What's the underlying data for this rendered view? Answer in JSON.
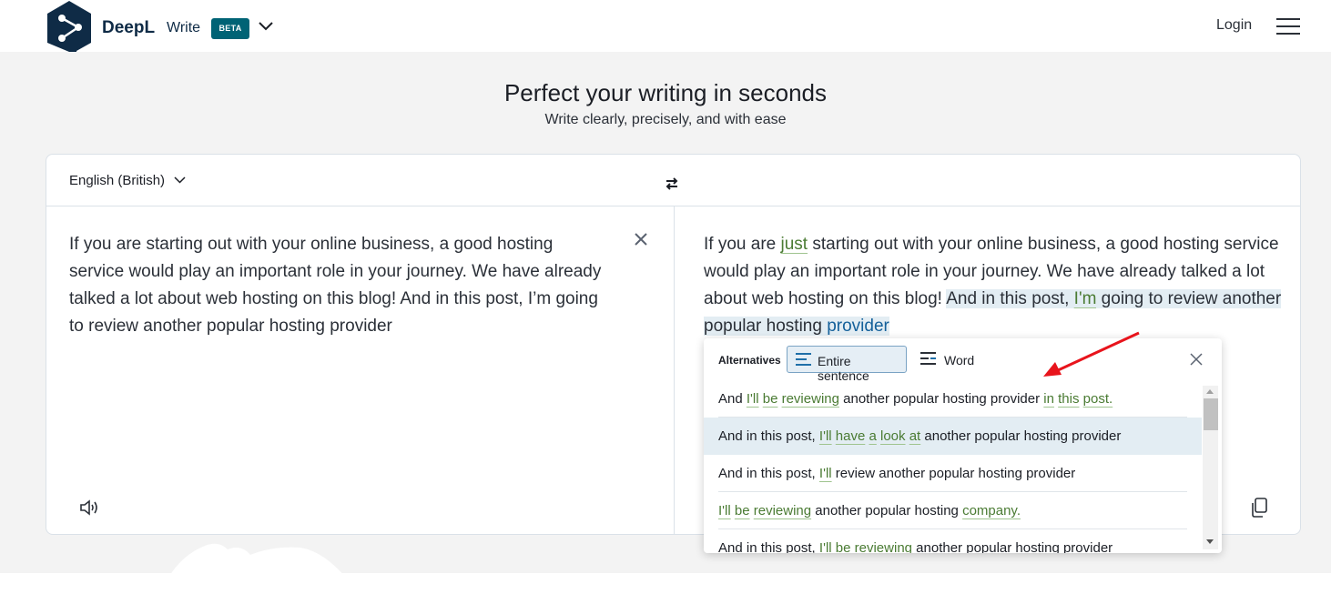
{
  "header": {
    "brand": "DeepL",
    "product": "Write",
    "badge": "BETA",
    "login": "Login"
  },
  "hero": {
    "title": "Perfect your writing in seconds",
    "subtitle": "Write clearly, precisely, and with ease"
  },
  "editor": {
    "language": "English (British)",
    "source_text": "If you are starting out with your online business, a good hosting service would play an important role in your journey. We have already talked a lot about web hosting on this blog! And in this post, I’m going to review another popular hosting provider",
    "output": {
      "p1": "If you are ",
      "p2": "just",
      "p3": " starting out with your online business, a good hosting service would play an important role in your journey. We have already talked a lot about web hosting on this blog!",
      "p4": " ",
      "p5": "And in this post, ",
      "p6": "I'm",
      "p7": " going to review another popular hosting ",
      "p8": "provider"
    }
  },
  "alternatives": {
    "label": "Alternatives",
    "tab_sentence": "Entire sentence",
    "tab_word": "Word",
    "items": [
      [
        {
          "t": "And ",
          "c": false
        },
        {
          "t": "I'll",
          "c": true
        },
        {
          "t": " ",
          "c": false
        },
        {
          "t": "be",
          "c": true
        },
        {
          "t": " ",
          "c": false
        },
        {
          "t": "reviewing",
          "c": true
        },
        {
          "t": " another popular hosting provider ",
          "c": false
        },
        {
          "t": "in",
          "c": true
        },
        {
          "t": " ",
          "c": false
        },
        {
          "t": "this",
          "c": true
        },
        {
          "t": " ",
          "c": false
        },
        {
          "t": "post.",
          "c": true
        }
      ],
      [
        {
          "t": "And in this post, ",
          "c": false
        },
        {
          "t": "I'll",
          "c": true
        },
        {
          "t": " ",
          "c": false
        },
        {
          "t": "have",
          "c": true
        },
        {
          "t": " ",
          "c": false
        },
        {
          "t": "a",
          "c": true
        },
        {
          "t": " ",
          "c": false
        },
        {
          "t": "look",
          "c": true
        },
        {
          "t": " ",
          "c": false
        },
        {
          "t": "at",
          "c": true
        },
        {
          "t": " another popular hosting provider",
          "c": false
        }
      ],
      [
        {
          "t": "And in this post, ",
          "c": false
        },
        {
          "t": "I'll",
          "c": true
        },
        {
          "t": " review another popular hosting provider",
          "c": false
        }
      ],
      [
        {
          "t": "I'll",
          "c": true
        },
        {
          "t": " ",
          "c": false
        },
        {
          "t": "be",
          "c": true
        },
        {
          "t": " ",
          "c": false
        },
        {
          "t": "reviewing",
          "c": true
        },
        {
          "t": " another popular hosting ",
          "c": false
        },
        {
          "t": "company.",
          "c": true
        }
      ],
      [
        {
          "t": "And in this post, ",
          "c": false
        },
        {
          "t": "I'll",
          "c": true
        },
        {
          "t": " ",
          "c": false
        },
        {
          "t": "be",
          "c": true
        },
        {
          "t": " ",
          "c": false
        },
        {
          "t": "reviewing",
          "c": true
        },
        {
          "t": " another popular hosting provider",
          "c": false
        }
      ]
    ],
    "selected_index": 1
  },
  "colors": {
    "brand": "#0f2b46",
    "badge": "#006375",
    "change": "#4a7b33",
    "highlight": "#e3edf3",
    "annotation_arrow": "#e8141c"
  }
}
